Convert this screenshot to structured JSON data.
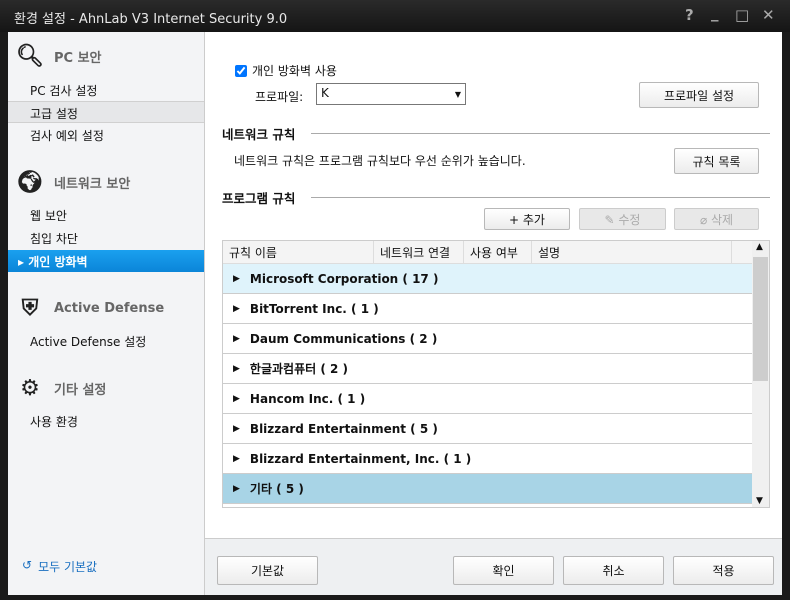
{
  "window": {
    "title": "환경 설정 - AhnLab V3 Internet Security 9.0",
    "help": "?",
    "minimize": "_",
    "maximize": "□",
    "close": "✕"
  },
  "sidebar": {
    "groups": [
      {
        "label": "PC 보안",
        "icon": "magnifier-icon",
        "items": [
          "PC 검사 설정",
          "고급 설정",
          "검사 예외 설정"
        ]
      },
      {
        "label": "네트워크 보안",
        "icon": "globe-icon",
        "items": [
          "웹 보안",
          "침입 차단",
          "개인 방화벽"
        ]
      },
      {
        "label": "Active Defense",
        "icon": "shield-check-icon",
        "items": [
          "Active Defense 설정"
        ]
      },
      {
        "label": "기타 설정",
        "icon": "gear-icon",
        "items": [
          "사용 환경"
        ]
      }
    ],
    "selected": "개인 방화벽",
    "reset_all": "모두 기본값"
  },
  "firewall": {
    "enable_label": "개인 방화벽 사용",
    "enabled": true,
    "profile_label": "프로파일:",
    "profile_value": "K",
    "profile_settings": "프로파일 설정"
  },
  "network_rules": {
    "title": "네트워크 규칙",
    "desc": "네트워크 규칙은 프로그램 규칙보다 우선 순위가 높습니다.",
    "list_button": "규칙 목록"
  },
  "program_rules": {
    "title": "프로그램 규칙",
    "add": "+ 추가",
    "edit": "✎ 수정",
    "delete": "⌀ 삭제",
    "columns": [
      "규칙 이름",
      "네트워크 연결",
      "사용 여부",
      "설명"
    ],
    "rows": [
      "Microsoft Corporation ( 17 )",
      "BitTorrent Inc. ( 1 )",
      "Daum Communications ( 2 )",
      "한글과컴퓨터 ( 2 )",
      "Hancom Inc. ( 1 )",
      "Blizzard Entertainment ( 5 )",
      "Blizzard Entertainment, Inc. ( 1 )",
      "기타 ( 5 )"
    ]
  },
  "footer": {
    "default": "기본값",
    "ok": "확인",
    "cancel": "취소",
    "apply": "적용"
  },
  "colors": {
    "accent": "#0b85d8",
    "row_hover": "#dff3fb",
    "row_selected": "#a8d4e6"
  }
}
